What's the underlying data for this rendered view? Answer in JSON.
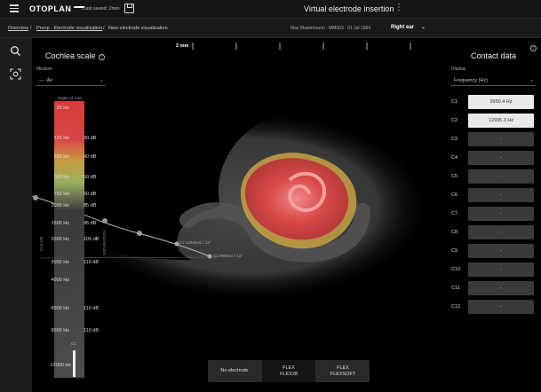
{
  "header": {
    "logo": "OTOPLAN",
    "last_saved": "Last saved: 2min",
    "title": "Virtual electrode insertion"
  },
  "breadcrumb": {
    "items": [
      "Overview",
      "Preop - Electrode visualization",
      "New electrode visualization"
    ],
    "separator": "/"
  },
  "patient": {
    "info": "Max Mustermann · MM003 · 01 Jul 1964",
    "ear": "Right ear"
  },
  "cochlea_scale": {
    "title": "Cochlea scale",
    "medium_label": "Medium",
    "medium_value": "Air",
    "organ_label": "Organ of corti",
    "color_axis": "COLOR",
    "saturation_axis": "SATURATION",
    "frequencies": [
      "20 Hz",
      "125 Hz",
      "250 Hz",
      "500 Hz",
      "750 Hz",
      "1000 Hz",
      "1500 Hz",
      "2000 Hz",
      "3000 Hz",
      "4000 Hz",
      "6000 Hz",
      "8000 Hz",
      "12000 Hz"
    ],
    "levels": [
      "30 dB",
      "40 dB",
      "50 dB",
      "60 dB",
      "85 dB",
      "95 dB",
      "105 dB",
      "110 dB",
      "110 dB",
      "110 dB"
    ],
    "slider_label": "C1"
  },
  "viewer": {
    "ruler_label": "2 mm",
    "electrode_labels": [
      "C2 12935Hz / 13°",
      "C1 9950Hz / 13°"
    ]
  },
  "contact_data": {
    "title": "Contact data",
    "display_label": "Display",
    "display_value": "Frequency (Hz)",
    "contacts": [
      {
        "label": "C1",
        "value": "9950.4 Hz"
      },
      {
        "label": "C2",
        "value": "12935.3 Hz"
      },
      {
        "label": "C3",
        "value": "-"
      },
      {
        "label": "C4",
        "value": "-"
      },
      {
        "label": "C5",
        "value": "-"
      },
      {
        "label": "C6",
        "value": "-"
      },
      {
        "label": "C7",
        "value": "-"
      },
      {
        "label": "C8",
        "value": "-"
      },
      {
        "label": "C9",
        "value": "-"
      },
      {
        "label": "C10",
        "value": "-"
      },
      {
        "label": "C11",
        "value": "-"
      },
      {
        "label": "C12",
        "value": "-"
      }
    ]
  },
  "electrode_selector": {
    "no_electrode": "No electrode",
    "flex28_line1": "FLEX",
    "flex28_line2": "FLEX28",
    "flexsoft_line1": "FLEX",
    "flexsoft_line2": "FLEXSOFT"
  },
  "help_icon": "?"
}
